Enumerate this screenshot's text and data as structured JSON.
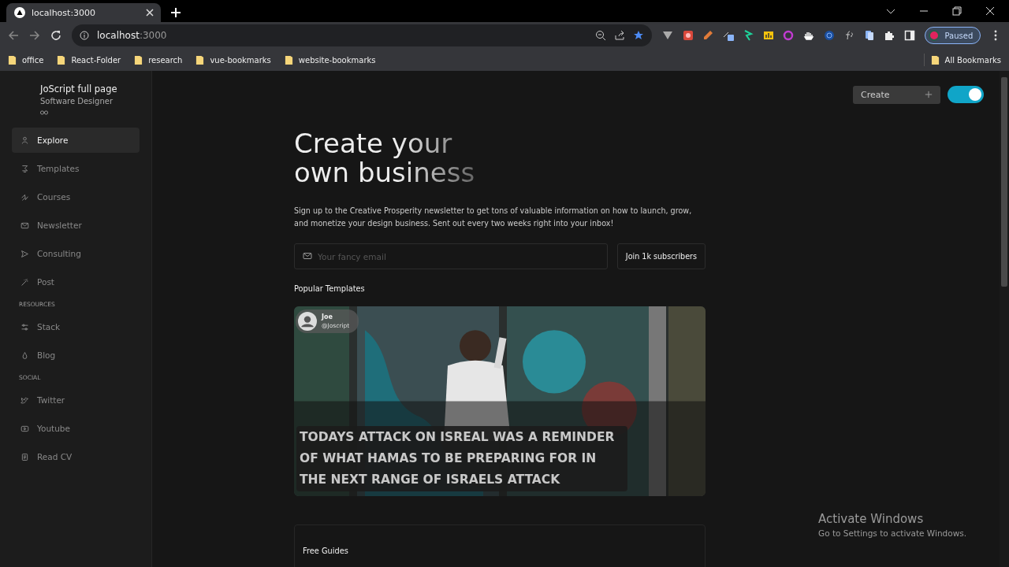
{
  "browser": {
    "tab": {
      "title": "localhost:3000",
      "selected": true
    },
    "address": {
      "host": "localhost",
      "port": ":3000"
    },
    "profile": {
      "label": "Paused"
    },
    "bookmarks": [
      "office",
      "React-Folder",
      "research",
      "vue-bookmarks",
      "website-bookmarks"
    ],
    "all_bookmarks": "All Bookmarks"
  },
  "sidebar": {
    "name": "JoScript full page",
    "role": "Software Designer",
    "groups": [
      {
        "items": [
          {
            "label": "Explore",
            "selected": true
          },
          {
            "label": "Templates",
            "selected": false
          },
          {
            "label": "Courses",
            "selected": false
          },
          {
            "label": "Newsletter",
            "selected": false
          },
          {
            "label": "Consulting",
            "selected": false
          },
          {
            "label": "Post",
            "selected": false
          }
        ]
      },
      {
        "heading": "RESOURCES",
        "items": [
          {
            "label": "Stack",
            "selected": false
          },
          {
            "label": "Blog",
            "selected": false
          }
        ]
      },
      {
        "heading": "SOCIAL",
        "items": [
          {
            "label": "Twitter",
            "selected": false
          },
          {
            "label": "Youtube",
            "selected": false
          },
          {
            "label": "Read CV",
            "selected": false
          }
        ]
      }
    ]
  },
  "topbar": {
    "create_button": "Create",
    "theme_toggle": {
      "on": true
    }
  },
  "hero": {
    "title": "Create your own business",
    "description": "Sign up to the Creative Prosperity newsletter to get tons of valuable information on how to launch, grow, and monetize your design business. Sent out every two weeks right into your inbox!"
  },
  "subscribe": {
    "placeholder": "Your fancy email",
    "button": "Join 1k subscribers"
  },
  "popular": {
    "heading": "Popular Templates",
    "card": {
      "kind": "picture",
      "author": "Joe",
      "handle": "@Joscript",
      "headline": "TODAYS ATTACK ON ISREAL WAS A REMINDER OF WHAT HAMAS TO BE PREPARING FOR IN THE NEXT RANGE OF ISRAELS ATTACK"
    }
  },
  "guides": {
    "heading": "Free Guides"
  },
  "os_notice": {
    "title": "Activate Windows",
    "text": "Go to Settings to activate Windows."
  }
}
